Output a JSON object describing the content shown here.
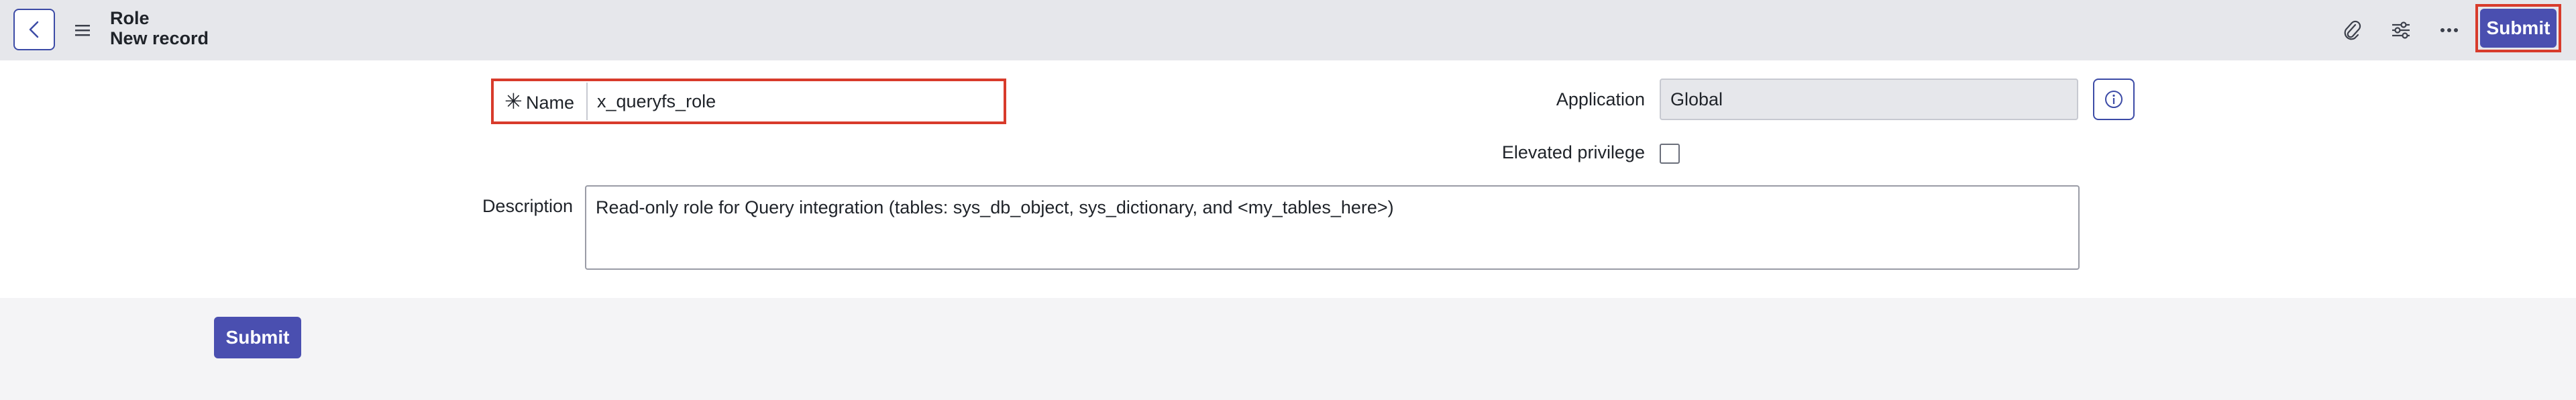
{
  "header": {
    "title": "Role",
    "subtitle": "New record",
    "icons": [
      "back-icon",
      "menu-icon",
      "attachment-icon",
      "settings-sliders-icon",
      "more-icon"
    ],
    "submit_label": "Submit"
  },
  "form": {
    "name": {
      "label": "Name",
      "required_marker": "✳",
      "value": "x_queryfs_role"
    },
    "application": {
      "label": "Application",
      "value": "Global"
    },
    "elevated_privilege": {
      "label": "Elevated privilege",
      "checked": false
    },
    "description": {
      "label": "Description",
      "value": "Read-only role for Query integration (tables: sys_db_object, sys_dictionary, and <my_tables_here>)"
    }
  },
  "footer": {
    "submit_label": "Submit"
  },
  "colors": {
    "accent": "#4a4fb0",
    "highlight": "#d83b2b",
    "header_bg": "#e6e7eb"
  }
}
